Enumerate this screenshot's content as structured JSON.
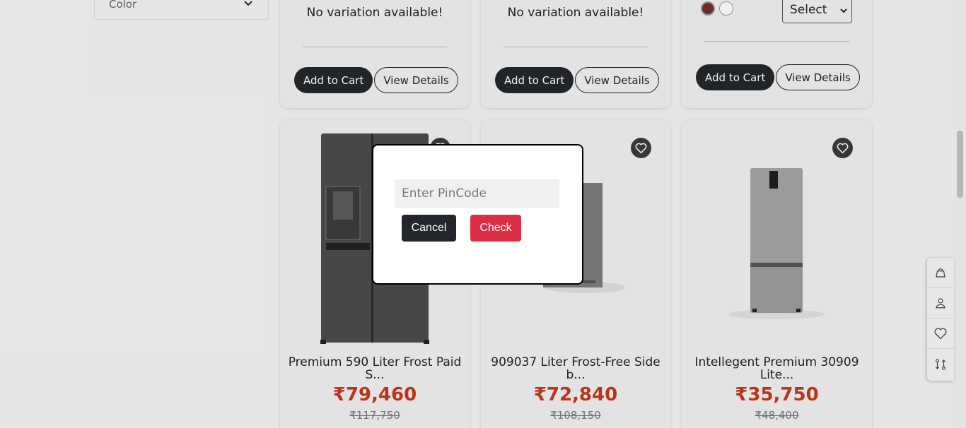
{
  "filter": {
    "label": "Color",
    "icon": "chevron-down-icon"
  },
  "top_cards": [
    {
      "message": "No variation available!",
      "cart_label": "Add to Cart",
      "details_label": "View Details"
    },
    {
      "message": "No variation available!",
      "cart_label": "Add to Cart",
      "details_label": "View Details"
    },
    {
      "swatches": [
        "#7a2b2f",
        "#ffffff"
      ],
      "select_value": "Select",
      "cart_label": "Add to Cart",
      "details_label": "View Details"
    }
  ],
  "products": [
    {
      "name": "Premium 590 Liter Frost Paid S...",
      "price": "₹79,460",
      "old_price": "₹117,750"
    },
    {
      "name": "909037 Liter Frost-Free Side b...",
      "price": "₹72,840",
      "old_price": "₹108,150"
    },
    {
      "name": "Intellegent Premium 30909 Lite...",
      "price": "₹35,750",
      "old_price": "₹48,400"
    }
  ],
  "floating_actions": [
    "shopping-bag-icon",
    "user-icon",
    "heart-icon",
    "compare-icon"
  ],
  "modal": {
    "placeholder": "Enter PinCode",
    "value": "",
    "cancel_label": "Cancel",
    "check_label": "Check"
  },
  "colors": {
    "dark": "#23262b",
    "accent_red": "#dc2f45",
    "price_red": "#c8361c"
  }
}
